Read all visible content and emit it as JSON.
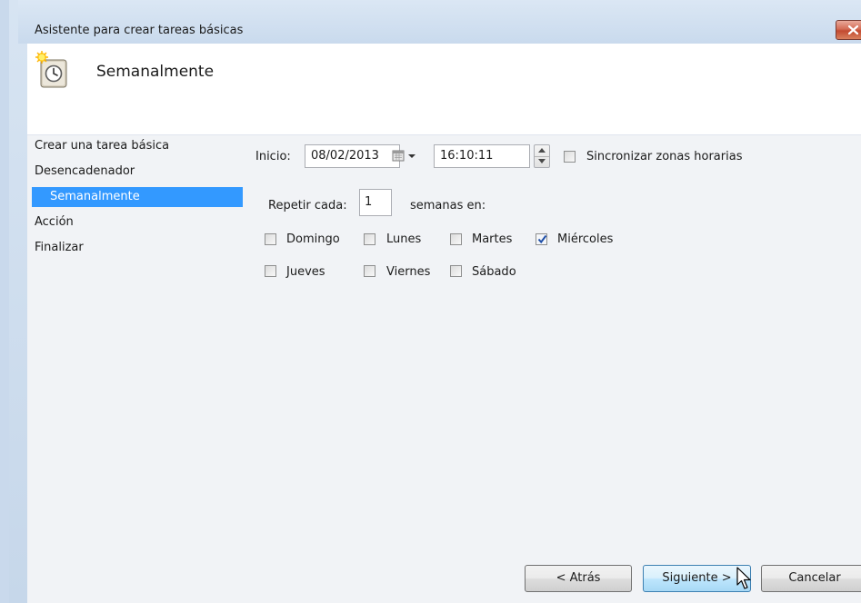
{
  "window": {
    "title": "Asistente para crear tareas básicas"
  },
  "header": {
    "title": "Semanalmente",
    "icon": "clock-icon"
  },
  "nav": {
    "items": [
      {
        "label": "Crear una tarea básica",
        "selected": false
      },
      {
        "label": "Desencadenador",
        "selected": false
      },
      {
        "label": "Semanalmente",
        "selected": true
      },
      {
        "label": "Acción",
        "selected": false
      },
      {
        "label": "Finalizar",
        "selected": false
      }
    ]
  },
  "form": {
    "start_label": "Inicio:",
    "start_date": "08/02/2013",
    "start_time": "16:10:11",
    "sync_label": "Sincronizar zonas horarias",
    "sync_checked": false,
    "repeat_label": "Repetir cada:",
    "repeat_value": "1",
    "weeks_label": "semanas en:",
    "days": [
      {
        "label": "Domingo",
        "checked": false
      },
      {
        "label": "Lunes",
        "checked": false
      },
      {
        "label": "Martes",
        "checked": false
      },
      {
        "label": "Miércoles",
        "checked": true
      },
      {
        "label": "Jueves",
        "checked": false
      },
      {
        "label": "Viernes",
        "checked": false
      },
      {
        "label": "Sábado",
        "checked": false
      }
    ]
  },
  "buttons": {
    "back": "< Atrás",
    "next": "Siguiente >",
    "cancel": "Cancelar"
  },
  "colors": {
    "selection": "#3399ff",
    "close_button": "#c24a30",
    "checkmark": "#1f4fa8"
  }
}
